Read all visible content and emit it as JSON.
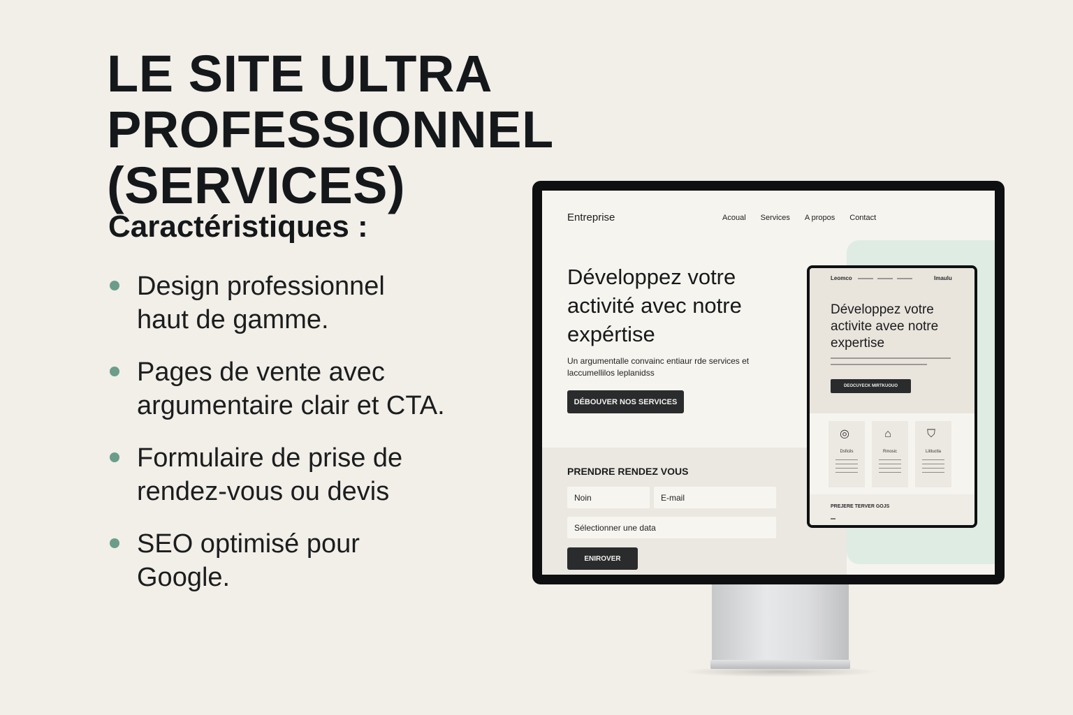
{
  "title": {
    "line1": "LE SITE ULTRA PROFESSIONNEL",
    "line2": "(SERVICES)"
  },
  "features": {
    "heading": "Caractéristiques :",
    "items": [
      "Design professionnel\nhaut de gamme.",
      "Pages de vente avec\nargumentaire clair et CTA.",
      "Formulaire de prise de\nrendez-vous ou devis",
      "SEO optimisé pour\nGoogle."
    ],
    "bullet_color": "#6b9d8a"
  },
  "site": {
    "brand": "Entreprise",
    "nav": [
      "Acoual",
      "Services",
      "A propos",
      "Contact"
    ],
    "hero_title": "Développez votre activité avec notre expértise",
    "hero_text": "Un argumentalle convainc entiaur rde services et laccumellilos leplanidss",
    "hero_button": "DÉBOUVER NOS SERVICES",
    "form": {
      "title": "PRENDRE RENDEZ VOUS",
      "name_placeholder": "Noin",
      "email_placeholder": "E-mail",
      "date_placeholder": "Sélectionner une data",
      "submit": "ENIROVER"
    },
    "accent_green": "#dfece3"
  },
  "tablet": {
    "brand": "Leomco",
    "right_label": "Imaulu",
    "title": "Développez votre activite avee notre expertise",
    "button": "DEOCUYECK MIRTKUOUO",
    "cards": [
      {
        "icon": "target-icon",
        "label": "Dsficils"
      },
      {
        "icon": "house-chart-icon",
        "label": "Rmosic"
      },
      {
        "icon": "shield-icon",
        "label": "Litituctla"
      }
    ],
    "footer_title": "PREJERE TERVER GOJS"
  }
}
